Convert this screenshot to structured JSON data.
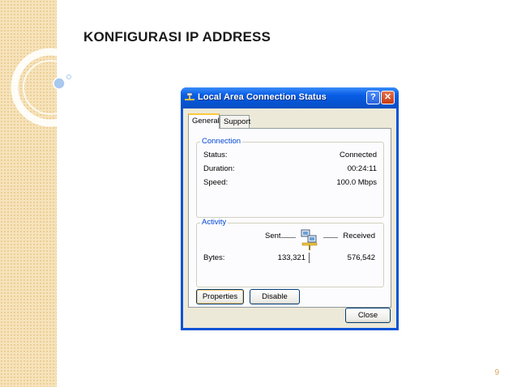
{
  "slide": {
    "title": "KONFIGURASI IP ADDRESS",
    "page_number": "9"
  },
  "window": {
    "title": "Local Area Connection Status",
    "help_label": "?",
    "close_label": "✕"
  },
  "tabs": [
    {
      "label": "General",
      "active": true
    },
    {
      "label": "Support",
      "active": false
    }
  ],
  "connection": {
    "legend": "Connection",
    "rows": [
      {
        "label": "Status:",
        "value": "Connected"
      },
      {
        "label": "Duration:",
        "value": "00:24:11"
      },
      {
        "label": "Speed:",
        "value": "100.0 Mbps"
      }
    ]
  },
  "activity": {
    "legend": "Activity",
    "sent_label": "Sent",
    "received_label": "Received",
    "bytes_label": "Bytes:",
    "bytes_sent": "133,321",
    "bytes_received": "576,542"
  },
  "buttons": {
    "properties": "Properties",
    "disable": "Disable",
    "close": "Close"
  },
  "colors": {
    "titlebar": "#0a5fe6",
    "client_bg": "#ece9d8",
    "legend_text": "#0046d5",
    "slide_strip": "#f6e3bb"
  },
  "icons": {
    "title_icon": "network-connection-icon",
    "activity_icon": "network-computers-icon"
  }
}
